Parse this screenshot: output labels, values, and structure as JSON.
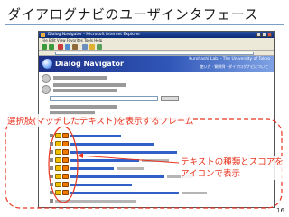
{
  "slide": {
    "title": "ダイアログナビのユーザインタフェース",
    "page_number": "16"
  },
  "window": {
    "title_bar": "Dialog Navigator - Microsoft Internet Explorer",
    "menu": "File Edit View Favorites Tools Help"
  },
  "app": {
    "name": "Dialog Navigator",
    "lab": "Kurohashi Lab. · The University of Tokyo",
    "links": "使い方 · 質問例 · ダイアログナビについて"
  },
  "annotations": {
    "frame_label": "選択肢(マッチしたテキスト)を表示するフレーム",
    "icon_label_line1": "テキストの種類とスコアを",
    "icon_label_line2": "アイコンで表示"
  },
  "colors": {
    "accent_red": "#e8341f",
    "header_blue": "#1c2f86",
    "annotation_ellipse": "#e8341f"
  },
  "icons": {
    "score_icon": "folder-icon",
    "type_icon": "document-icon"
  }
}
